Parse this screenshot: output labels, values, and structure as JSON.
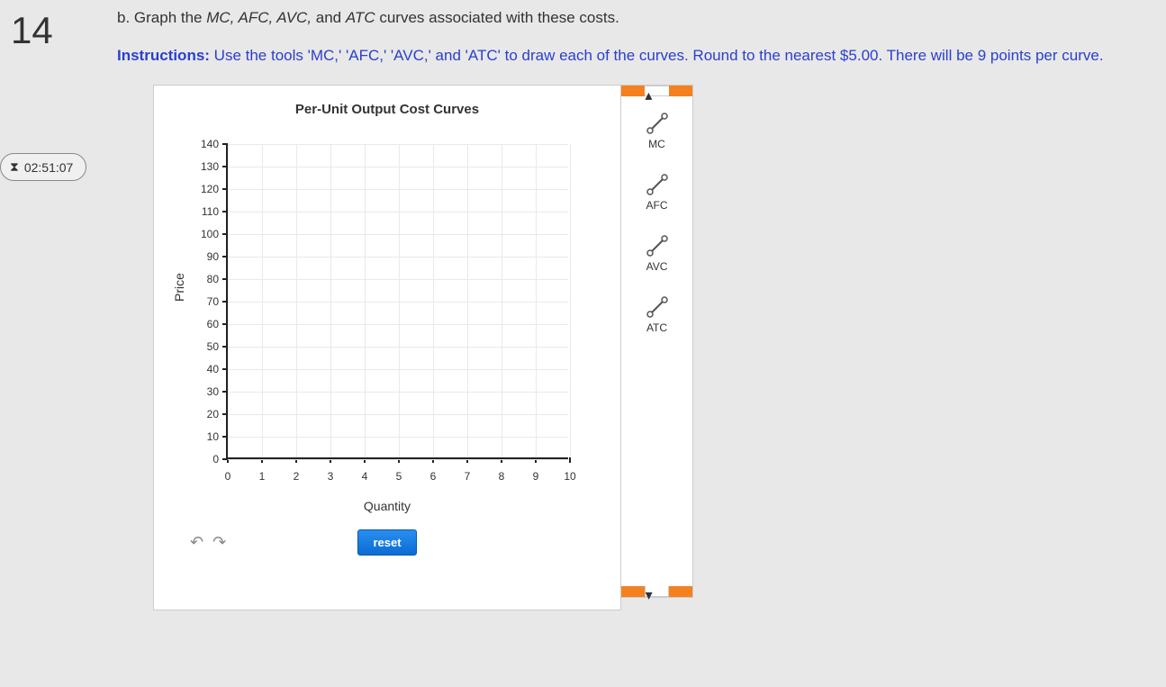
{
  "question_number": "14",
  "timer": "02:51:07",
  "prompt": {
    "prefix": "b. Graph the ",
    "terms": "MC, AFC, AVC,",
    "after_terms": " and ",
    "last_term": "ATC",
    "suffix": " curves associated with these costs."
  },
  "instructions": {
    "label": "Instructions:",
    "text": " Use the tools 'MC,' 'AFC,' 'AVC,' and 'ATC' to draw each of the curves. Round to the nearest $5.00. There will be 9 points per curve."
  },
  "tools": [
    {
      "name": "MC"
    },
    {
      "name": "AFC"
    },
    {
      "name": "AVC"
    },
    {
      "name": "ATC"
    }
  ],
  "buttons": {
    "reset": "reset",
    "undo": "↶",
    "redo": "↷"
  },
  "chart_data": {
    "type": "scatter",
    "title": "Per-Unit Output Cost Curves",
    "xlabel": "Quantity",
    "ylabel": "Price",
    "xlim": [
      0,
      10
    ],
    "ylim": [
      0,
      140
    ],
    "x_ticks": [
      0,
      1,
      2,
      3,
      4,
      5,
      6,
      7,
      8,
      9,
      10
    ],
    "y_ticks": [
      0,
      10,
      20,
      30,
      40,
      50,
      60,
      70,
      80,
      90,
      100,
      110,
      120,
      130,
      140
    ],
    "series": []
  }
}
